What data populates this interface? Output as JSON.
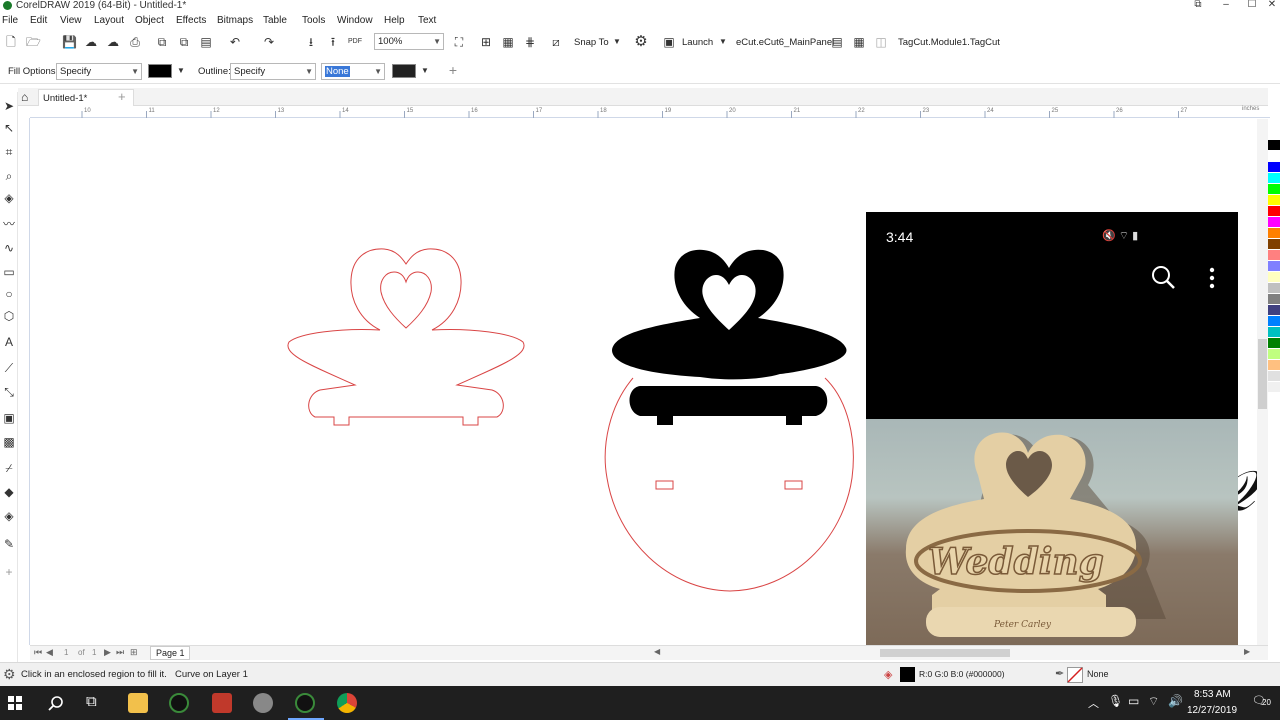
{
  "window": {
    "title": "CorelDRAW 2019 (64-Bit) - Untitled-1*",
    "controls": [
      "⧉",
      "–",
      "☐",
      "✕"
    ]
  },
  "menu": [
    "File",
    "Edit",
    "View",
    "Layout",
    "Object",
    "Effects",
    "Bitmaps",
    "Table",
    "Tools",
    "Window",
    "Help",
    "Text"
  ],
  "toolbar": {
    "zoom": "100%",
    "snap_to": "Snap To",
    "launch": "Launch",
    "panel": "eCut.eCut6_MainPanel",
    "tagcut": "TagCut.Module1.TagCut"
  },
  "property_bar": {
    "fill_options_label": "Fill Options:",
    "fill_options_value": "Specify",
    "outline_label": "Outline:",
    "outline_value": "Specify",
    "outline_width": "None",
    "add_icon": "+"
  },
  "document_tab": "Untitled-1*",
  "ruler": {
    "units": "inches",
    "ticks": [
      "10",
      "11",
      "12",
      "13",
      "14",
      "15",
      "16",
      "17",
      "18",
      "19",
      "20",
      "21",
      "22",
      "23",
      "24",
      "25",
      "26",
      "27"
    ]
  },
  "page_nav": {
    "current": "1",
    "of": "of",
    "total": "1",
    "page_tab": "Page 1"
  },
  "status": {
    "hint": "Click in an enclosed region to fill it.",
    "selection": "Curve on Layer 1",
    "fill_color": "R:0 G:0 B:0 (#000000)",
    "outline": "None"
  },
  "phone": {
    "time": "3:44",
    "status_icons": "🔇 ⌔ ▮",
    "photo_text": "Wedding",
    "stand_names": "Peter  Carley"
  },
  "taskbar": {
    "time": "8:53 AM",
    "date": "12/27/2019",
    "notifications": "20"
  },
  "palette_colors": [
    "#000000",
    "#ffffff",
    "#0000ff",
    "#00ffff",
    "#00ff00",
    "#ffff00",
    "#ff0000",
    "#ff00ff",
    "#ff8000",
    "#804000",
    "#ff8080",
    "#8080ff",
    "#ffffc0",
    "#c0c0c0",
    "#808080",
    "#404080",
    "#0080ff",
    "#00c0c0",
    "#008000",
    "#c0ff80",
    "#ffc080",
    "#e0e0e0",
    "#f0f0f0"
  ],
  "colors": {
    "outline_red": "#d94545",
    "accent_blue": "#3a78d8"
  }
}
